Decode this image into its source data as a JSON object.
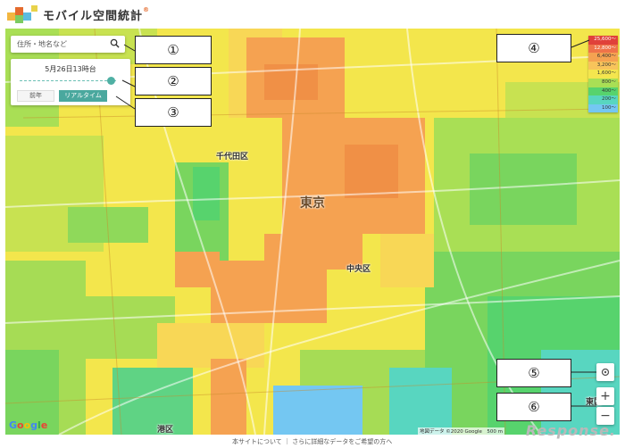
{
  "app": {
    "title": "モバイル空間統計",
    "title_sup": "®"
  },
  "search": {
    "placeholder": "住所・地名など",
    "icon": "search-icon"
  },
  "time": {
    "date_label": "5月26日13時台",
    "prev_year_label": "前年",
    "realtime_label": "リアルタイム",
    "slider_level": 0.95
  },
  "legend": {
    "items": [
      {
        "label": "25,600〜",
        "color": "#e0413a"
      },
      {
        "label": "12,800〜",
        "color": "#ef7349"
      },
      {
        "label": "6,400〜",
        "color": "#f5a251"
      },
      {
        "label": "3,200〜",
        "color": "#f8c45b"
      },
      {
        "label": "1,600〜",
        "color": "#f4e64e"
      },
      {
        "label": "800〜",
        "color": "#a9df55"
      },
      {
        "label": "400〜",
        "color": "#57d36d"
      },
      {
        "label": "200〜",
        "color": "#58d6c0"
      },
      {
        "label": "100〜",
        "color": "#74c7f2"
      }
    ]
  },
  "callouts": [
    "①",
    "②",
    "③",
    "④",
    "⑤",
    "⑥"
  ],
  "map": {
    "places": [
      "千代田区",
      "東京",
      "中央区",
      "港区",
      "東区"
    ],
    "controls": {
      "locate": "locate-icon",
      "zoom_in": "+",
      "zoom_out": "−"
    },
    "google_logo": "Google",
    "credits": "地図データ ©2020 Google　500 m"
  },
  "footer": {
    "links": "本サイトについて ｜ さらに詳細なデータをご希望の方へ",
    "brand": "Response."
  },
  "colors": {
    "accent": "#4aa89e",
    "orange": "#f5a251",
    "yellow": "#f4e64e",
    "green": "#a9df55",
    "teal": "#57d36d"
  }
}
